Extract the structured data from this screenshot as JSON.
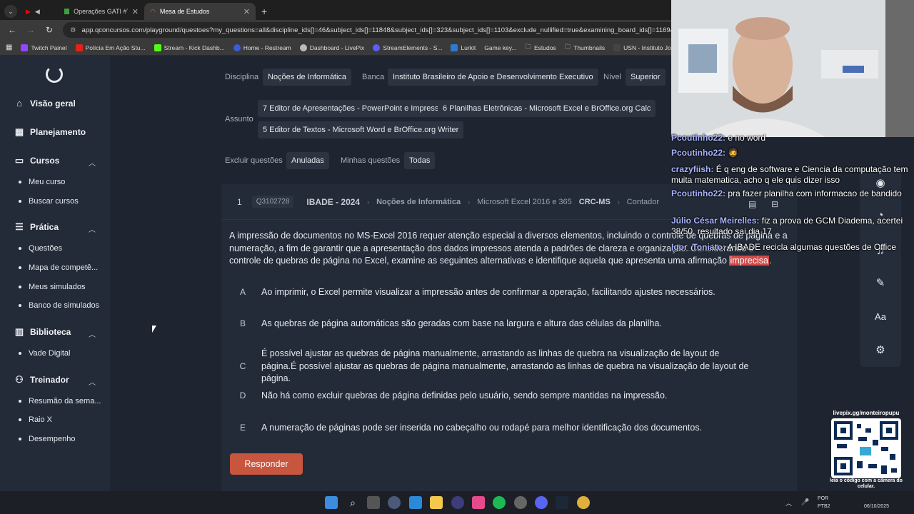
{
  "browser": {
    "tabs": [
      {
        "label": "Operações GATI #71"
      },
      {
        "label": "Mesa de Estudos"
      }
    ],
    "url": "app.qconcursos.com/playground/questoes?my_questions=all&discipline_ids[]=46&subject_ids[]=11848&subject_ids[]=323&subject_ids[]=1103&exclude_nullified=true&examining_board_ids[]=1169&sch",
    "bookmarks": [
      {
        "label": "Twitch Painel",
        "color": "#9146ff"
      },
      {
        "label": "Polícia Em Ação Stu...",
        "color": "#e62117"
      },
      {
        "label": "Stream - Kick Dashb...",
        "color": "#53fc18"
      },
      {
        "label": "Home - Restream",
        "color": "#3b5bdb"
      },
      {
        "label": "Dashboard - LivePix",
        "color": "#bbbbbb"
      },
      {
        "label": "StreamElements - S...",
        "color": "#5d5dff"
      },
      {
        "label": "Lurkit",
        "color": "#2b7bd6"
      },
      {
        "label": "Game key...",
        "color": "#999999"
      },
      {
        "label": "Estudos",
        "color": "folder"
      },
      {
        "label": "Thumbnails",
        "color": "folder"
      },
      {
        "label": "USN - Instituto Jone...",
        "color": "#444444"
      }
    ]
  },
  "sidebar": {
    "sections": [
      {
        "label": "Visão geral",
        "icon": "home-icon"
      },
      {
        "label": "Planejamento",
        "icon": "calendar-icon"
      },
      {
        "label": "Cursos",
        "icon": "book-icon",
        "items": [
          "Meu curso",
          "Buscar cursos"
        ]
      },
      {
        "label": "Prática",
        "icon": "checklist-icon",
        "items": [
          "Questões",
          "Mapa de competê...",
          "Meus simulados",
          "Banco de simulados"
        ]
      },
      {
        "label": "Biblioteca",
        "icon": "library-icon",
        "items": [
          "Vade Digital"
        ]
      },
      {
        "label": "Treinador",
        "icon": "trainer-icon",
        "items": [
          "Resumão da sema...",
          "Raio X",
          "Desempenho"
        ]
      }
    ]
  },
  "filters": {
    "disciplina_label": "Disciplina",
    "disciplina": "Noções de Informática",
    "banca_label": "Banca",
    "banca": "Instituto Brasileiro de Apoio e Desenvolvimento Executivo",
    "nivel_label": "Nível",
    "nivel": "Superior",
    "assunto_label": "Assunto",
    "assuntos": [
      "7 Editor de Apresentações - PowerPoint e Impress",
      "6 Planilhas Eletrônicas - Microsoft Excel e BrOffice.org Calc",
      "5 Editor de Textos - Microsoft Word e BrOffice.org Writer"
    ],
    "excluir_label": "Excluir questões",
    "excluir": "Anuladas",
    "minhas_label": "Minhas questões",
    "minhas": "Todas"
  },
  "question": {
    "number": "1",
    "id": "Q3102728",
    "board": "IBADE - 2024",
    "discipline": "Noções de Informática",
    "subject": "Microsoft Excel 2016 e 365",
    "org": "CRC-MS",
    "role": "Contador",
    "text_lines": [
      "A impressão de documentos no MS-Excel 2016 requer atenção especial a diversos elementos, incluindo o controle de quebras de página e a",
      "numeração, a fim de garantir que a apresentação dos dados impressos atenda a padrões de clareza e organização. Considerando o",
      "controle de quebras de página no Excel, examine as seguintes alternativas e identifique aquela que apresenta uma afirmação "
    ],
    "highlight": "imprecisa",
    "highlight_end": ".",
    "options": [
      {
        "letter": "A",
        "text": "Ao imprimir, o Excel permite visualizar a impressão antes de confirmar a operação, facilitando ajustes necessários."
      },
      {
        "letter": "B",
        "text": "As quebras de página automáticas são geradas com base na largura e altura das células da planilha."
      },
      {
        "letter": "C",
        "text": "É possível ajustar as quebras de página manualmente, arrastando as linhas de quebra na visualização de layout de página.É possível ajustar as quebras de página manualmente, arrastando as linhas de quebra na visualização de layout de página."
      },
      {
        "letter": "D",
        "text": "Não há como excluir quebras de página definidas pelo usuário, sendo sempre mantidas na impressão."
      },
      {
        "letter": "E",
        "text": "A numeração de páginas pode ser inserida no cabeçalho ou rodapé para melhor identificação dos documentos."
      }
    ],
    "respond_label": "Responder"
  },
  "toolbar": {
    "font_label": "Aa"
  },
  "chat": [
    {
      "name": "Pcoutinho22:",
      "msg": "e no word"
    },
    {
      "name": "Pcoutinho22:",
      "msg": "🧔"
    },
    {
      "name": "crazyfiish:",
      "msg": "É q eng de software e Ciencia da computação tem muita matematica, acho q ele quis dizer isso"
    },
    {
      "name": "Pcoutinho22:",
      "msg": "pra fazer planilha com informacao de bandido"
    },
    {
      "name": "Júlio César Meirelles:",
      "msg": "fiz a prova de GCM Diadema, acertei 38/50, resultado sai dia 17"
    },
    {
      "name": "Igor_Toniato:",
      "msg": "A IBADE recicla algumas questões de Office"
    }
  ],
  "qr": {
    "top": "livepix.gg/monteiropupu",
    "caption": "leia o código com a câmera do celular."
  },
  "taskbar": {
    "lang": "POR",
    "layout": "PTB2",
    "date": "06/10/2025"
  }
}
